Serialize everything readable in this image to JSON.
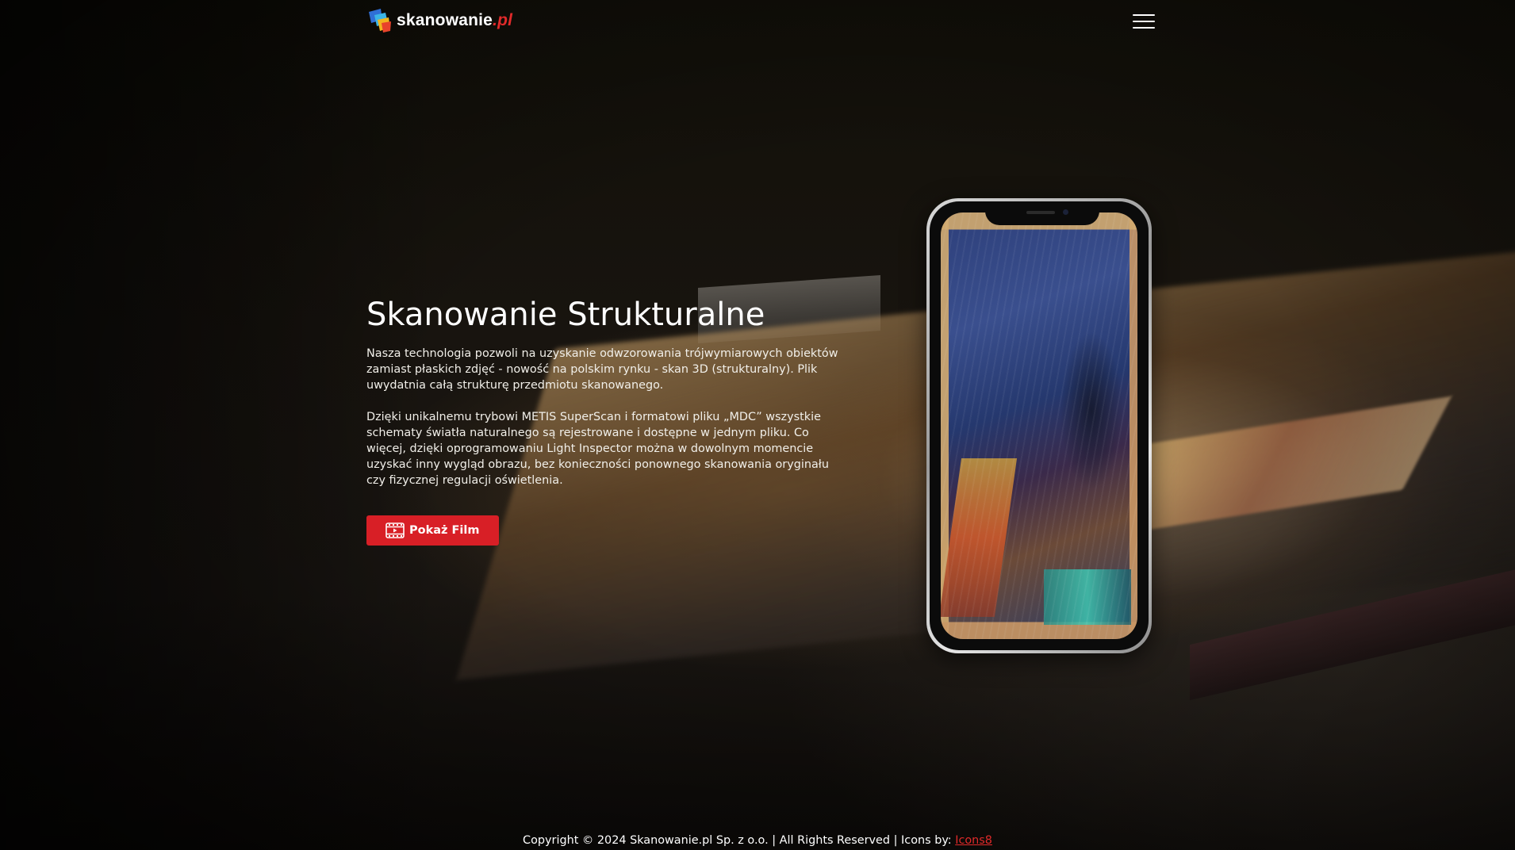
{
  "header": {
    "logo_text": "skanowanie",
    "logo_tld": ".pl",
    "menu_icon": "hamburger-menu-icon"
  },
  "hero": {
    "title": "Skanowanie Strukturalne",
    "paragraph1": "Nasza technologia pozwoli na uzyskanie odwzorowania trójwymiarowych obiektów zamiast płaskich zdjęć - nowość na polskim rynku - skan 3D (strukturalny). Plik uwydatnia całą strukturę przedmiotu skanowanego.",
    "paragraph2": "Dzięki unikalnemu trybowi METIS SuperScan i formatowi pliku „MDC” wszystkie schematy światła naturalnego są rejestrowane i dostępne w jednym pliku. Co więcej, dzięki oprogramowaniu Light Inspector można w dowolnym momencie uzyskać inny wygląd obrazu, bez konieczności ponownego skanowania oryginału czy fizycznej regulacji oświetlenia.",
    "cta_label": "Pokaż Film",
    "cta_icon": "film-icon"
  },
  "footer": {
    "copyright": "Copyright © 2024 Skanowanie.pl Sp. z o.o. | All Rights Reserved | Icons by: ",
    "icons_link": "Icons8"
  },
  "colors": {
    "accent": "#d81f26",
    "link": "#e02a2a",
    "text": "#ffffff"
  }
}
